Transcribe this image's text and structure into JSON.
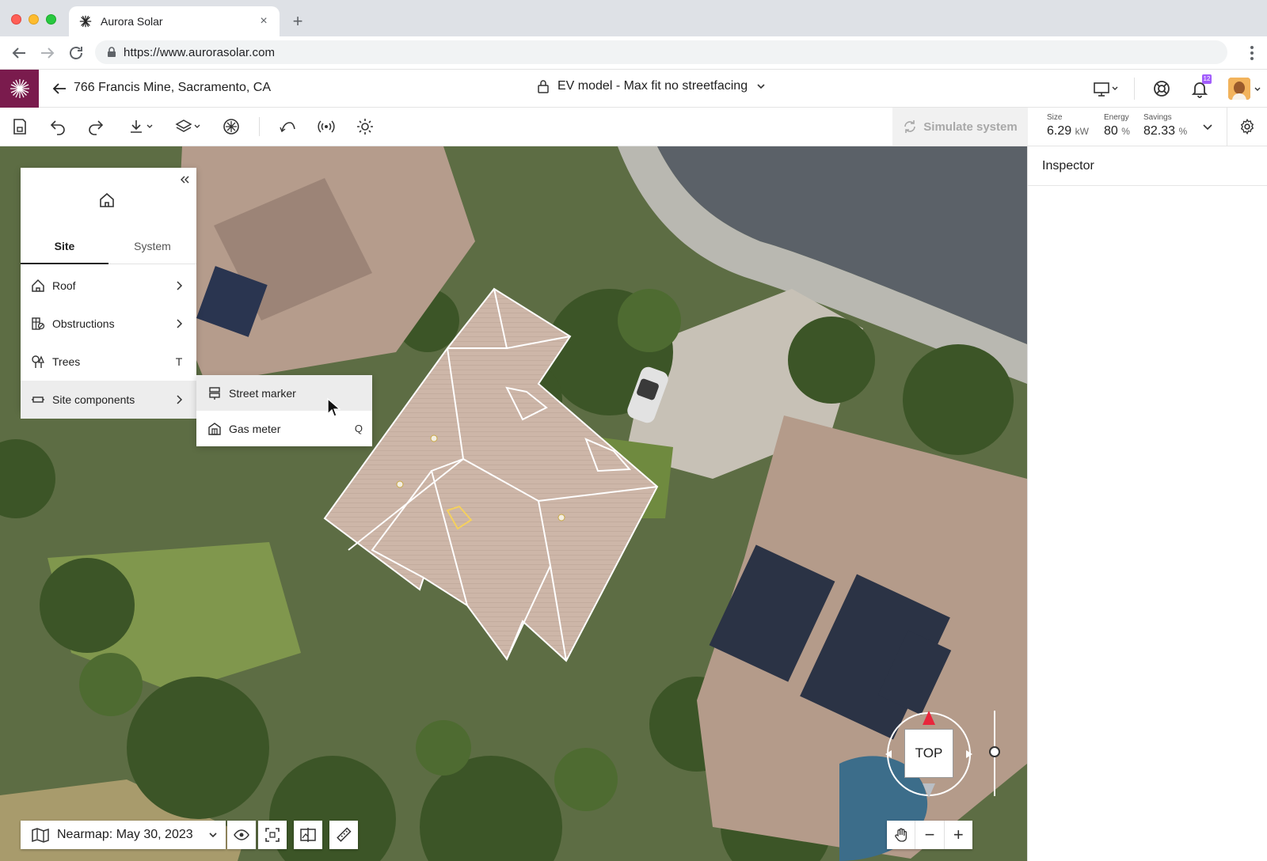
{
  "browser": {
    "tab_title": "Aurora Solar",
    "url": "https://www.aurorasolar.com",
    "new_tab_symbol": "+",
    "close_tab_symbol": "×"
  },
  "header": {
    "address": "766 Francis Mine, Sacramento, CA",
    "design_name": "EV model - Max fit no streetfacing",
    "notification_count": "12"
  },
  "toolbar": {
    "simulate_label": "Simulate system",
    "metrics": [
      {
        "label": "Size",
        "value": "6.29",
        "unit": "kW"
      },
      {
        "label": "Energy",
        "value": "80",
        "unit": "%"
      },
      {
        "label": "Savings",
        "value": "82.33",
        "unit": "%"
      }
    ]
  },
  "inspector": {
    "title": "Inspector"
  },
  "left_panel": {
    "tabs": [
      {
        "label": "Site",
        "active": true
      },
      {
        "label": "System",
        "active": false
      }
    ],
    "items": [
      {
        "label": "Roof",
        "icon": "roof-icon",
        "right": "chevron"
      },
      {
        "label": "Obstructions",
        "icon": "obstructions-icon",
        "right": "chevron"
      },
      {
        "label": "Trees",
        "icon": "tree-icon",
        "right": "T"
      },
      {
        "label": "Site components",
        "icon": "site-components-icon",
        "right": "chevron"
      }
    ]
  },
  "submenu": {
    "items": [
      {
        "label": "Street marker",
        "icon": "street-marker-icon",
        "shortcut": ""
      },
      {
        "label": "Gas meter",
        "icon": "gas-meter-icon",
        "shortcut": "Q"
      }
    ]
  },
  "map": {
    "imagery_label": "Nearmap: May 30, 2023",
    "compass_label": "TOP",
    "zoom_out": "−",
    "zoom_in": "+"
  },
  "colors": {
    "brand": "#7a1b4d",
    "notification_badge": "#a25dfc",
    "compass_north": "#e8263c"
  }
}
